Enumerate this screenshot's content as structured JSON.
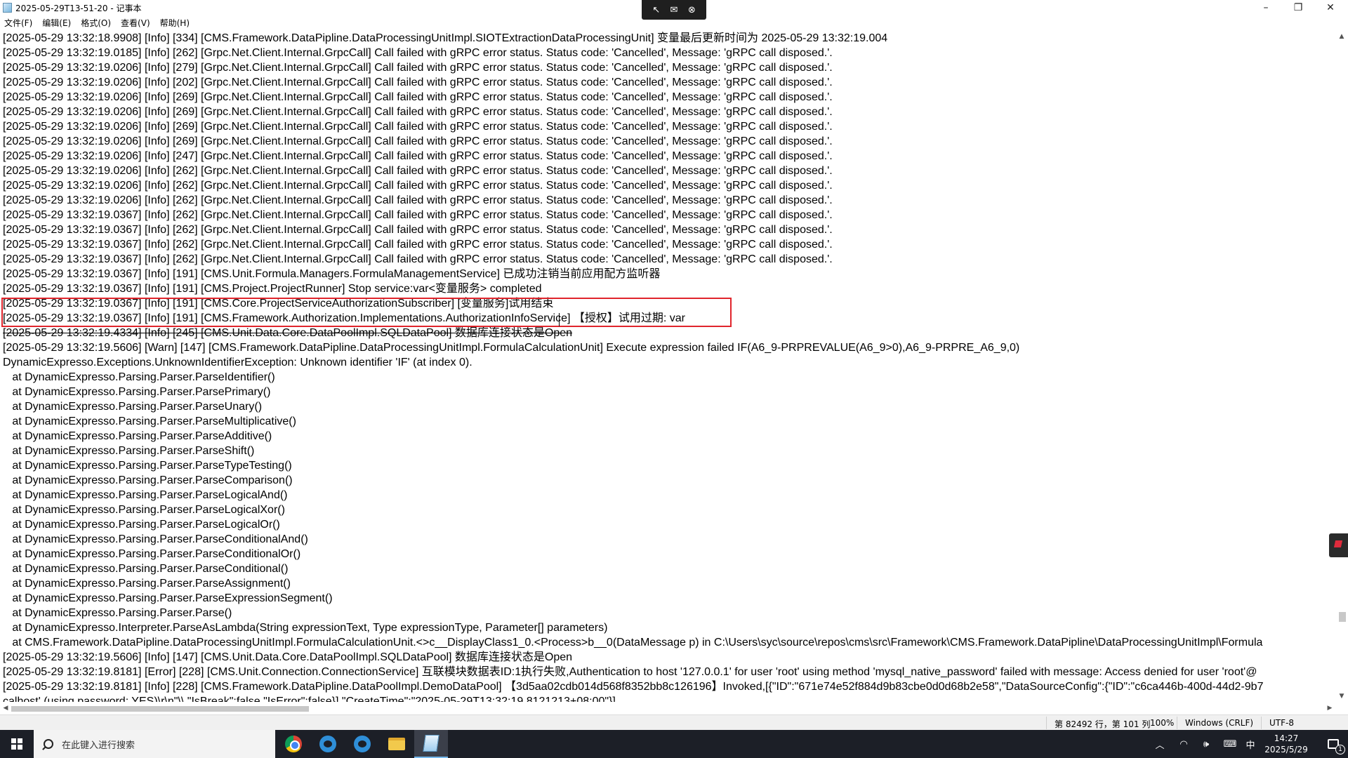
{
  "window": {
    "title": "2025-05-29T13-51-20 - 记事本",
    "minimize_glyph": "–",
    "maximize_glyph": "❐",
    "close_glyph": "✕"
  },
  "recorder_toolbar": {
    "icons": [
      "cursor-icon",
      "mail-icon",
      "close-circle-icon"
    ],
    "glyphs": [
      "↖",
      "✉",
      "⊗"
    ]
  },
  "menu": {
    "items": [
      "文件(F)",
      "编辑(E)",
      "格式(O)",
      "查看(V)",
      "帮助(H)"
    ]
  },
  "editor": {
    "lines": [
      "[2025-05-29 13:32:18.9908] [Info] [334] [CMS.Framework.DataPipline.DataProcessingUnitImpl.SIOTExtractionDataProcessingUnit] 变量最后更新时间为 2025-05-29 13:32:19.004",
      "[2025-05-29 13:32:19.0185] [Info] [262] [Grpc.Net.Client.Internal.GrpcCall] Call failed with gRPC error status. Status code: 'Cancelled', Message: 'gRPC call disposed.'.",
      "[2025-05-29 13:32:19.0206] [Info] [279] [Grpc.Net.Client.Internal.GrpcCall] Call failed with gRPC error status. Status code: 'Cancelled', Message: 'gRPC call disposed.'.",
      "[2025-05-29 13:32:19.0206] [Info] [202] [Grpc.Net.Client.Internal.GrpcCall] Call failed with gRPC error status. Status code: 'Cancelled', Message: 'gRPC call disposed.'.",
      "[2025-05-29 13:32:19.0206] [Info] [269] [Grpc.Net.Client.Internal.GrpcCall] Call failed with gRPC error status. Status code: 'Cancelled', Message: 'gRPC call disposed.'.",
      "[2025-05-29 13:32:19.0206] [Info] [269] [Grpc.Net.Client.Internal.GrpcCall] Call failed with gRPC error status. Status code: 'Cancelled', Message: 'gRPC call disposed.'.",
      "[2025-05-29 13:32:19.0206] [Info] [269] [Grpc.Net.Client.Internal.GrpcCall] Call failed with gRPC error status. Status code: 'Cancelled', Message: 'gRPC call disposed.'.",
      "[2025-05-29 13:32:19.0206] [Info] [269] [Grpc.Net.Client.Internal.GrpcCall] Call failed with gRPC error status. Status code: 'Cancelled', Message: 'gRPC call disposed.'.",
      "[2025-05-29 13:32:19.0206] [Info] [247] [Grpc.Net.Client.Internal.GrpcCall] Call failed with gRPC error status. Status code: 'Cancelled', Message: 'gRPC call disposed.'.",
      "[2025-05-29 13:32:19.0206] [Info] [262] [Grpc.Net.Client.Internal.GrpcCall] Call failed with gRPC error status. Status code: 'Cancelled', Message: 'gRPC call disposed.'.",
      "[2025-05-29 13:32:19.0206] [Info] [262] [Grpc.Net.Client.Internal.GrpcCall] Call failed with gRPC error status. Status code: 'Cancelled', Message: 'gRPC call disposed.'.",
      "[2025-05-29 13:32:19.0206] [Info] [262] [Grpc.Net.Client.Internal.GrpcCall] Call failed with gRPC error status. Status code: 'Cancelled', Message: 'gRPC call disposed.'.",
      "[2025-05-29 13:32:19.0367] [Info] [262] [Grpc.Net.Client.Internal.GrpcCall] Call failed with gRPC error status. Status code: 'Cancelled', Message: 'gRPC call disposed.'.",
      "[2025-05-29 13:32:19.0367] [Info] [262] [Grpc.Net.Client.Internal.GrpcCall] Call failed with gRPC error status. Status code: 'Cancelled', Message: 'gRPC call disposed.'.",
      "[2025-05-29 13:32:19.0367] [Info] [262] [Grpc.Net.Client.Internal.GrpcCall] Call failed with gRPC error status. Status code: 'Cancelled', Message: 'gRPC call disposed.'.",
      "[2025-05-29 13:32:19.0367] [Info] [262] [Grpc.Net.Client.Internal.GrpcCall] Call failed with gRPC error status. Status code: 'Cancelled', Message: 'gRPC call disposed.'.",
      "[2025-05-29 13:32:19.0367] [Info] [191] [CMS.Unit.Formula.Managers.FormulaManagementService] 已成功注销当前应用配方监听器",
      "[2025-05-29 13:32:19.0367] [Info] [191] [CMS.Project.ProjectRunner] Stop service:var<变量服务> completed",
      "[2025-05-29 13:32:19.0367] [Info] [191] [CMS.Core.ProjectServiceAuthorizationSubscriber] [变量服务]试用结束",
      "[2025-05-29 13:32:19.0367] [Info] [191] [CMS.Framework.Authorization.Implementations.AuthorizationInfoService] 【授权】试用过期: var",
      "[2025-05-29 13:32:19.4334] [Info] [245] [CMS.Unit.Data.Core.DataPoolImpl.SQLDataPool] 数据库连接状态是Open",
      "[2025-05-29 13:32:19.5606] [Warn] [147] [CMS.Framework.DataPipline.DataProcessingUnitImpl.FormulaCalculationUnit] Execute expression failed IF(A6_9-PRPREVALUE(A6_9>0),A6_9-PRPRE_A6_9,0)",
      "DynamicExpresso.Exceptions.UnknownIdentifierException: Unknown identifier 'IF' (at index 0).",
      "   at DynamicExpresso.Parsing.Parser.ParseIdentifier()",
      "   at DynamicExpresso.Parsing.Parser.ParsePrimary()",
      "   at DynamicExpresso.Parsing.Parser.ParseUnary()",
      "   at DynamicExpresso.Parsing.Parser.ParseMultiplicative()",
      "   at DynamicExpresso.Parsing.Parser.ParseAdditive()",
      "   at DynamicExpresso.Parsing.Parser.ParseShift()",
      "   at DynamicExpresso.Parsing.Parser.ParseTypeTesting()",
      "   at DynamicExpresso.Parsing.Parser.ParseComparison()",
      "   at DynamicExpresso.Parsing.Parser.ParseLogicalAnd()",
      "   at DynamicExpresso.Parsing.Parser.ParseLogicalXor()",
      "   at DynamicExpresso.Parsing.Parser.ParseLogicalOr()",
      "   at DynamicExpresso.Parsing.Parser.ParseConditionalAnd()",
      "   at DynamicExpresso.Parsing.Parser.ParseConditionalOr()",
      "   at DynamicExpresso.Parsing.Parser.ParseConditional()",
      "   at DynamicExpresso.Parsing.Parser.ParseAssignment()",
      "   at DynamicExpresso.Parsing.Parser.ParseExpressionSegment()",
      "   at DynamicExpresso.Parsing.Parser.Parse()",
      "   at DynamicExpresso.Interpreter.ParseAsLambda(String expressionText, Type expressionType, Parameter[] parameters)",
      "   at CMS.Framework.DataPipline.DataProcessingUnitImpl.FormulaCalculationUnit.<>c__DisplayClass1_0.<Process>b__0(DataMessage p) in C:\\Users\\syc\\source\\repos\\cms\\src\\Framework\\CMS.Framework.DataPipline\\DataProcessingUnitImpl\\Formula",
      "[2025-05-29 13:32:19.5606] [Info] [147] [CMS.Unit.Data.Core.DataPoolImpl.SQLDataPool] 数据库连接状态是Open",
      "[2025-05-29 13:32:19.8181] [Error] [228] [CMS.Unit.Connection.ConnectionService] 互联模块数据表ID:1执行失败,Authentication to host '127.0.0.1' for user 'root' using method 'mysql_native_password' failed with message: Access denied for user 'root'@",
      "[2025-05-29 13:32:19.8181] [Info] [228] [CMS.Framework.DataPipline.DataPoolImpl.DemoDataPool] 【3d5aa02cdb014d568f8352bb8c126196】Invoked,[{\"ID\":\"671e74e52f884d9b83cbe0d0d68b2e58\",\"DataSourceConfig\":{\"ID\":\"c6ca446b-400d-44d2-9b7",
      "calhost' (using password: YES)\\r\\n\"\\\\ \"IsBreak\":false,\"IsError\":false}],\"CreateTime\":\"2025-05-29T13:32:19.8121213+08:00\"}]"
    ]
  },
  "status_bar": {
    "position": "第 82492 行，第 101 列",
    "zoom": "100%",
    "line_ending": "Windows (CRLF)",
    "encoding": "UTF-8"
  },
  "taskbar": {
    "search_placeholder": "在此键入进行搜索",
    "ime": "中",
    "time": "14:27",
    "date": "2025/5/29",
    "notification_count": "1"
  }
}
